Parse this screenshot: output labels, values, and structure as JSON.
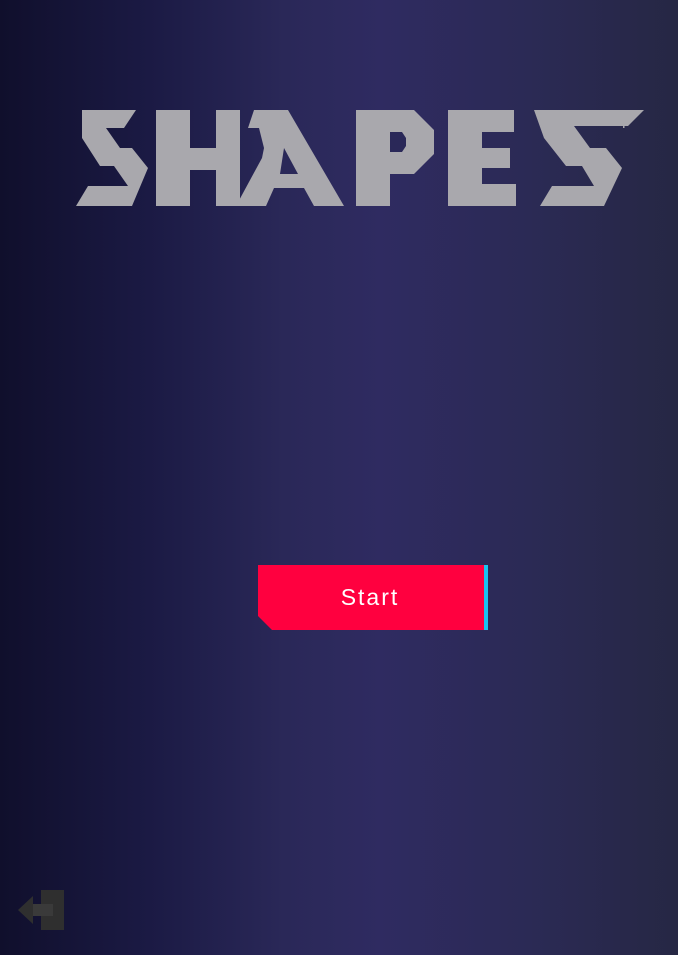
{
  "title": {
    "logo_text": "SHAPES"
  },
  "menu": {
    "start_label": "Start"
  },
  "exit": {
    "icon": "exit-door-icon"
  },
  "colors": {
    "background_start": "#100f2c",
    "background_mid": "#2f2b61",
    "logo": "#a9a8ad",
    "start_button": "#ff003f",
    "start_accent": "#19c4ef",
    "exit_icon": "#2f2f2f"
  }
}
